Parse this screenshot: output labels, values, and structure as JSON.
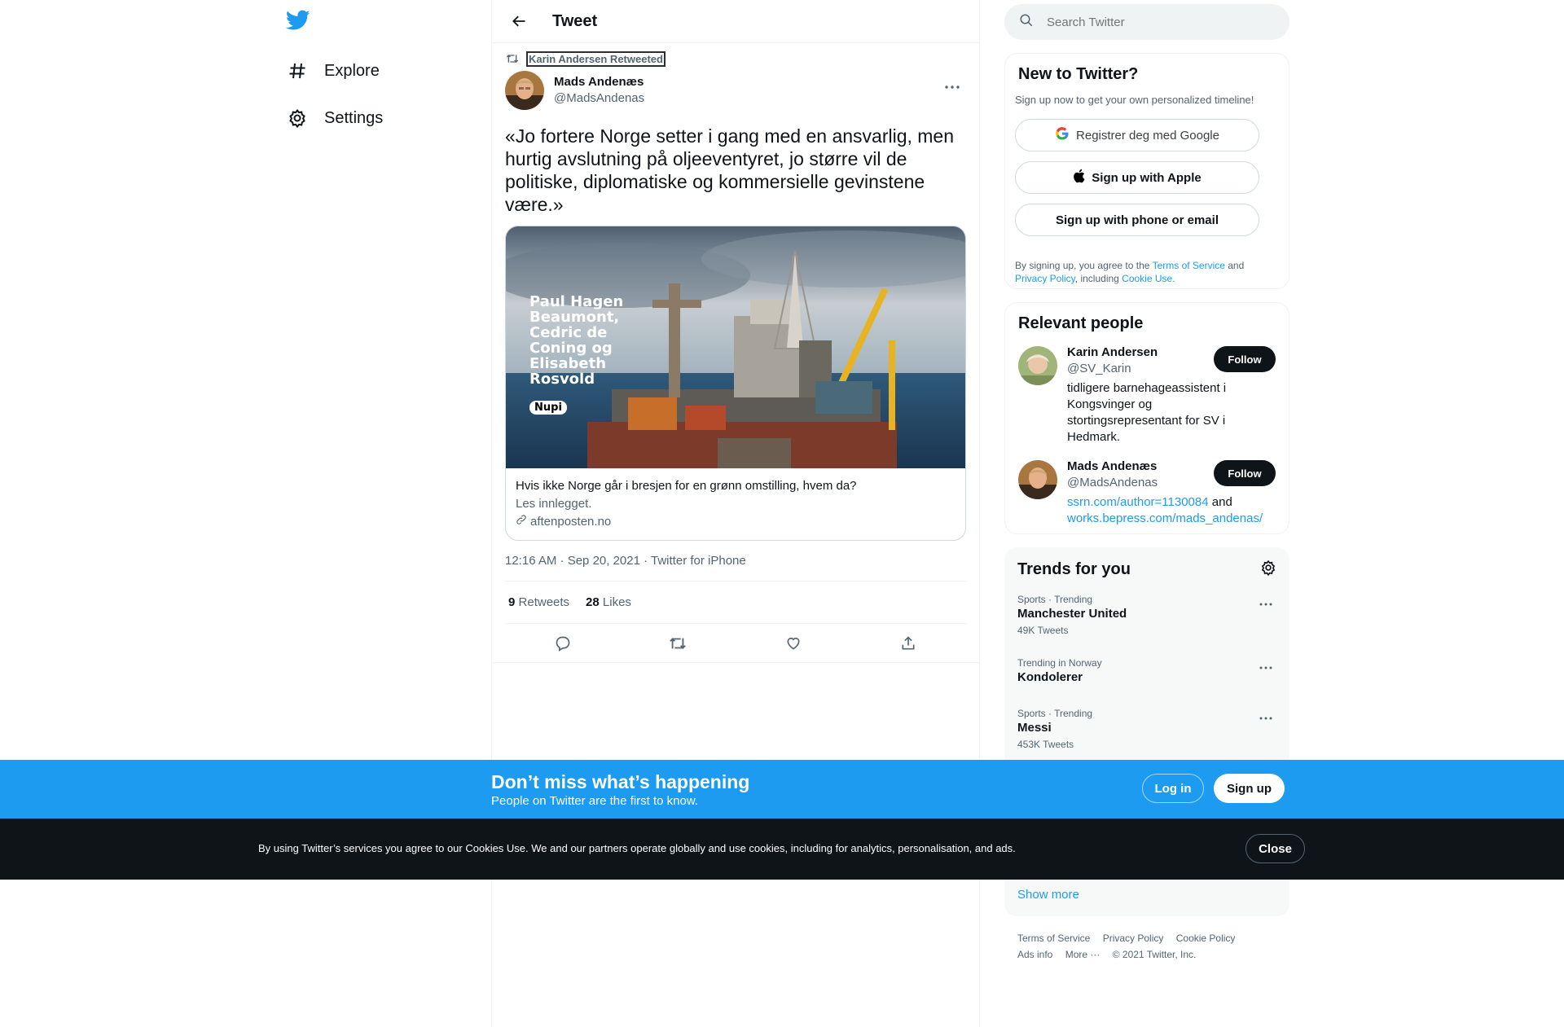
{
  "nav": {
    "explore": "Explore",
    "settings": "Settings"
  },
  "header": {
    "title": "Tweet"
  },
  "tweet": {
    "retweeted_by": "Karin Andersen Retweeted",
    "author_name": "Mads Andenæs",
    "author_handle": "@MadsAndenas",
    "text": "«Jo fortere Norge setter i gang med en ansvarlig, men hurtig avslutning på oljeeventyret, jo større vil de politiske, diplomatiske og kommersielle gevinstene være.»",
    "card": {
      "image_text": "Paul Hagen Beaumont, Cedric de Coning og Elisabeth Rosvold",
      "image_badge": "Nupi",
      "title": "Hvis ikke Norge går i bresjen for en grønn omstilling, hvem da?",
      "description": "Les innlegget.",
      "domain": "aftenposten.no"
    },
    "timestamp": "12:16 AM · Sep 20, 2021 · Twitter for iPhone",
    "retweets_count": "9",
    "retweets_label": "Retweets",
    "likes_count": "28",
    "likes_label": "Likes"
  },
  "search": {
    "placeholder": "Search Twitter"
  },
  "new_to_twitter": {
    "heading": "New to Twitter?",
    "subtitle": "Sign up now to get your own personalized timeline!",
    "google_label": "Registrer deg med Google",
    "apple_label": "Sign up with Apple",
    "phone_label": "Sign up with phone or email",
    "legal_1": "By signing up, you agree to the ",
    "legal_tos": "Terms of Service",
    "legal_and": " and",
    "legal_privacy": "Privacy Policy",
    "legal_including": ", including ",
    "legal_cookie": "Cookie Use."
  },
  "relevant_people": {
    "heading": "Relevant people",
    "people": [
      {
        "name": "Karin Andersen",
        "handle": "@SV_Karin",
        "bio": "tidligere barnehageassistent i Kongsvinger og stortingsrepresentant for SV i Hedmark.",
        "follow": "Follow"
      },
      {
        "name": "Mads Andenæs",
        "handle": "@MadsAndenas",
        "bio_link1": "ssrn.com/author=1130084",
        "bio_and": " and ",
        "bio_link2": "works.bepress.com/mads_andenas/",
        "follow": "Follow"
      }
    ]
  },
  "trends": {
    "heading": "Trends for you",
    "items": [
      {
        "meta": "Sports · Trending",
        "name": "Manchester United",
        "count": "49K Tweets"
      },
      {
        "meta": "Trending in Norway",
        "name": "Kondolerer",
        "count": ""
      },
      {
        "meta": "Sports · Trending",
        "name": "Messi",
        "count": "453K Tweets"
      }
    ],
    "show_more": "Show more"
  },
  "footer": {
    "tos": "Terms of Service",
    "privacy": "Privacy Policy",
    "cookie": "Cookie Policy",
    "ads": "Ads info",
    "more": "More ···",
    "copyright": "© 2021 Twitter, Inc."
  },
  "signup_banner": {
    "heading": "Don’t miss what’s happening",
    "subtitle": "People on Twitter are the first to know.",
    "login": "Log in",
    "signup": "Sign up"
  },
  "cookie_banner": {
    "text": "By using Twitter’s services you agree to our Cookies Use. We and our partners operate globally and use cookies, including for analytics, personalisation, and ads.",
    "close": "Close"
  },
  "colors": {
    "accent": "#1d9bf0",
    "text": "#0f1419",
    "secondary": "#536471",
    "cookie_bg": "#0f1419"
  }
}
